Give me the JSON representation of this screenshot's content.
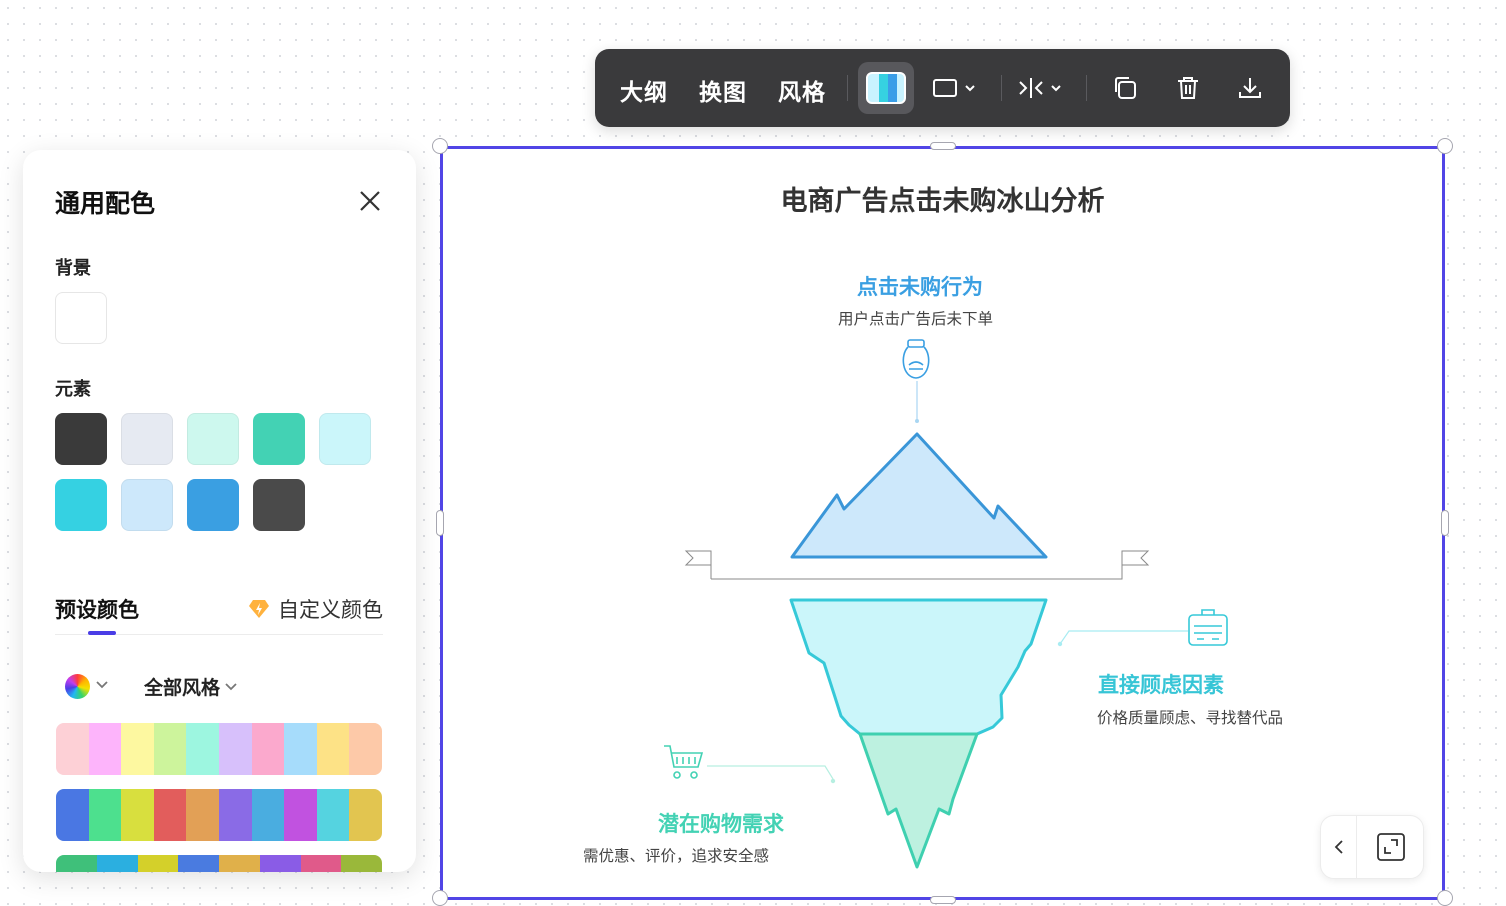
{
  "toolbar": {
    "outline_label": "大纲",
    "swap_label": "换图",
    "style_label": "风格",
    "items": [
      "palette-icon",
      "shape-icon",
      "align-icon",
      "copy-icon",
      "delete-icon",
      "download-icon"
    ]
  },
  "panel": {
    "title": "通用配色",
    "background_label": "背景",
    "background_color": "#ffffff",
    "elements_label": "元素",
    "element_colors": [
      "#3a3a3a",
      "#e6eaf2",
      "#cdf8ee",
      "#43d2b4",
      "#cbf6fa",
      "#35d1e2",
      "#cde8fb",
      "#3a9fe2",
      "#4a4a4a"
    ],
    "tab_preset": "预设颜色",
    "tab_custom": "自定义颜色",
    "style_filter": "全部风格",
    "palettes": [
      [
        "#fdd0d6",
        "#fdb4fb",
        "#fdf8a0",
        "#cdf49c",
        "#9df6e0",
        "#d7c0fb",
        "#fba9cd",
        "#a6dcfb",
        "#fde286",
        "#fdc9a8"
      ],
      [
        "#4a77e3",
        "#4de08e",
        "#d8df3e",
        "#e25d5c",
        "#e2a056",
        "#8a6be6",
        "#4aade0",
        "#c152e0",
        "#55d3e0",
        "#e2c550"
      ],
      [
        "#3fc07a",
        "#2bafe0",
        "#d4d02a",
        "#4a7be0",
        "#e0b04a",
        "#8a5ce6",
        "#e05a8a",
        "#9ab83a"
      ]
    ]
  },
  "diagram": {
    "title": "电商广告点击未购冰山分析",
    "top_title": "点击未购行为",
    "top_desc": "用户点击广告后未下单",
    "right_title": "直接顾虑因素",
    "right_desc": "价格质量顾虑、寻找替代品",
    "bottom_title": "潜在购物需求",
    "bottom_desc": "需优惠、评价，追求安全感",
    "colors": {
      "top_title": "#3a9fe2",
      "right_title": "#37c5d6",
      "bottom_title": "#43d2b4",
      "tip_fill": "#cde8fb",
      "tip_stroke": "#3a96d8",
      "under_fill": "#cbf6fa",
      "under_stroke": "#36c9d8",
      "deep_fill": "#bdf1e0",
      "deep_stroke": "#3fd0b0"
    }
  }
}
